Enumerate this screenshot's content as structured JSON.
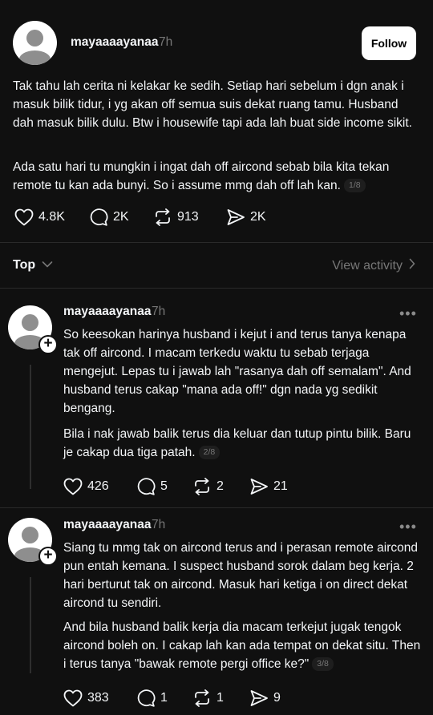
{
  "post": {
    "username": "mayaaaayanaa",
    "time": "7h",
    "follow_label": "Follow",
    "paragraph1": "Tak tahu lah cerita ni kelakar ke sedih. Setiap hari sebelum i dgn anak i masuk bilik tidur, i yg akan off semua suis dekat ruang tamu. Husband dah masuk bilik dulu. Btw i housewife tapi ada lah buat side income sikit.",
    "paragraph2": "Ada satu hari tu mungkin i ingat dah off aircond sebab bila kita tekan remote tu kan ada bunyi. So i assume mmg dah off lah kan.",
    "pager": "1/8",
    "likes": "4.8K",
    "replies": "2K",
    "reposts": "913",
    "shares": "2K"
  },
  "sort": {
    "label": "Top",
    "view_activity": "View activity"
  },
  "replies": [
    {
      "username": "mayaaaayanaa",
      "time": "7h",
      "paragraph1": "So keesokan harinya husband i kejut i and terus tanya kenapa tak off aircond. I macam terkedu waktu tu sebab terjaga mengejut. Lepas tu i jawab lah \"rasanya dah off semalam\". And husband terus cakap \"mana ada off!\" dgn nada yg sedikit bengang.",
      "paragraph2": "Bila i nak jawab balik terus dia keluar dan tutup pintu bilik. Baru je cakap dua tiga patah.",
      "pager": "2/8",
      "likes": "426",
      "replies": "5",
      "reposts": "2",
      "shares": "21"
    },
    {
      "username": "mayaaaayanaa",
      "time": "7h",
      "paragraph1": "Siang tu mmg tak on aircond terus and i perasan remote aircond pun entah kemana. I suspect husband sorok dalam beg kerja. 2 hari berturut tak on aircond. Masuk hari ketiga i on direct dekat aircond tu sendiri.",
      "paragraph2": "And bila husband balik kerja dia macam terkejut jugak tengok aircond boleh on. I cakap lah kan ada tempat on dekat situ. Then i terus tanya \"bawak remote pergi office ke?\"",
      "pager": "3/8",
      "likes": "383",
      "replies": "1",
      "reposts": "1",
      "shares": "9"
    }
  ]
}
